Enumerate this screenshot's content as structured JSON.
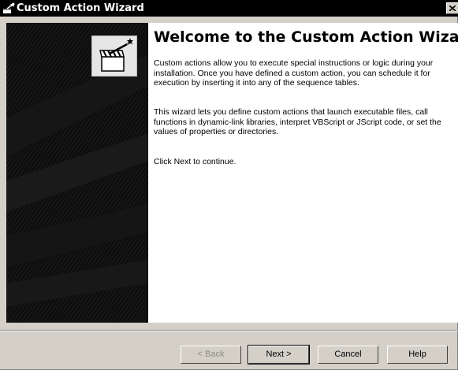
{
  "window": {
    "title": "Custom Action Wizard",
    "title_icon": "wizard-wand-icon",
    "close_icon": "close-icon"
  },
  "banner": {
    "icon": "clapperboard-wand-icon"
  },
  "content": {
    "heading": "Welcome to the Custom Action Wizard",
    "paragraphs": [
      "Custom actions allow you to execute special instructions or logic during your installation.  Once you have defined a custom action, you can schedule it for execution by inserting it into any of the sequence tables.",
      "This wizard lets you define custom actions that launch executable files, call functions in dynamic-link libraries, interpret VBScript or JScript code, or set the values of properties or directories.",
      "Click Next to continue."
    ]
  },
  "buttons": {
    "back": "< Back",
    "next": "Next >",
    "cancel": "Cancel",
    "help": "Help"
  }
}
